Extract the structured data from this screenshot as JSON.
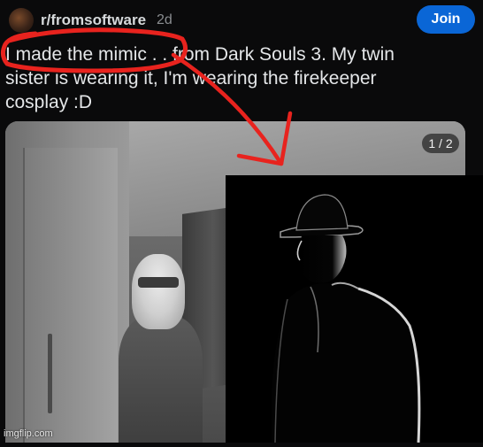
{
  "post": {
    "subreddit": "r/fromsoftware",
    "age": "2d",
    "join_label": "Join",
    "title_lines": [
      "I made the mimic . . from Dark Souls 3. My twin",
      "sister is wearing it, I'm wearing the firekeeper",
      "cosplay :D"
    ]
  },
  "media": {
    "page_indicator": "1 / 2"
  },
  "watermark": "imgflip.com",
  "colors": {
    "background": "#0a0a0b",
    "join_button": "#0a66d6",
    "annotation_red": "#e8231e"
  }
}
